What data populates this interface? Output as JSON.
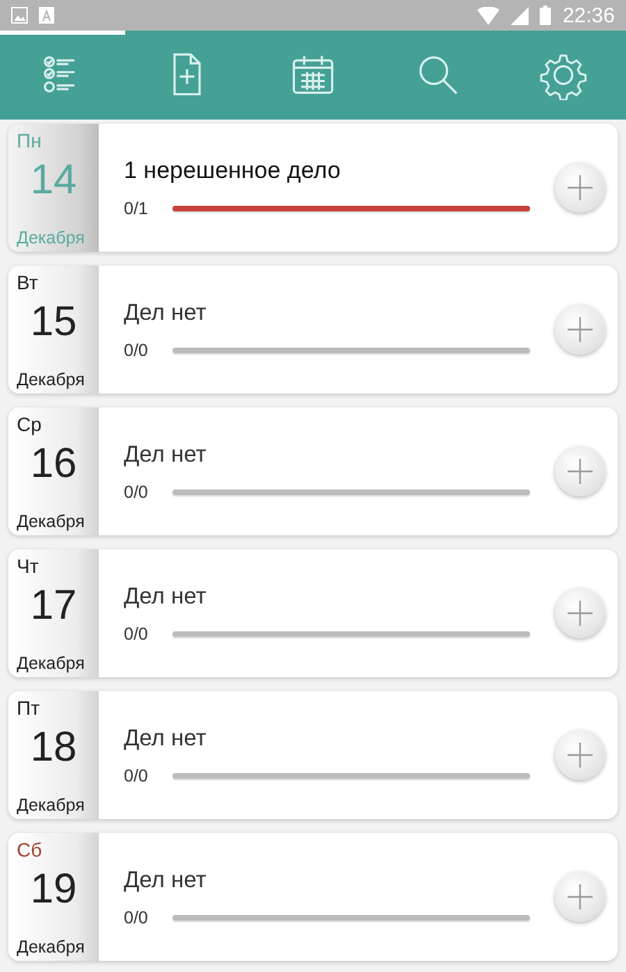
{
  "status_bar": {
    "time": "22:36"
  },
  "tabs": [
    {
      "selected": true
    },
    {
      "selected": false
    },
    {
      "selected": false
    },
    {
      "selected": false
    },
    {
      "selected": false
    }
  ],
  "days": [
    {
      "weekday": "Пн",
      "date": "14",
      "month": "Декабря",
      "today": true,
      "weekend": false,
      "title": "1 нерешенное дело",
      "count": "0/1",
      "level": 1
    },
    {
      "weekday": "Вт",
      "date": "15",
      "month": "Декабря",
      "today": false,
      "weekend": false,
      "title": "Дел нет",
      "count": "0/0",
      "level": 0
    },
    {
      "weekday": "Ср",
      "date": "16",
      "month": "Декабря",
      "today": false,
      "weekend": false,
      "title": "Дел нет",
      "count": "0/0",
      "level": 0
    },
    {
      "weekday": "Чт",
      "date": "17",
      "month": "Декабря",
      "today": false,
      "weekend": false,
      "title": "Дел нет",
      "count": "0/0",
      "level": 0
    },
    {
      "weekday": "Пт",
      "date": "18",
      "month": "Декабря",
      "today": false,
      "weekend": false,
      "title": "Дел нет",
      "count": "0/0",
      "level": 0
    },
    {
      "weekday": "Сб",
      "date": "19",
      "month": "Декабря",
      "today": false,
      "weekend": true,
      "title": "Дел нет",
      "count": "0/0",
      "level": 0
    }
  ]
}
